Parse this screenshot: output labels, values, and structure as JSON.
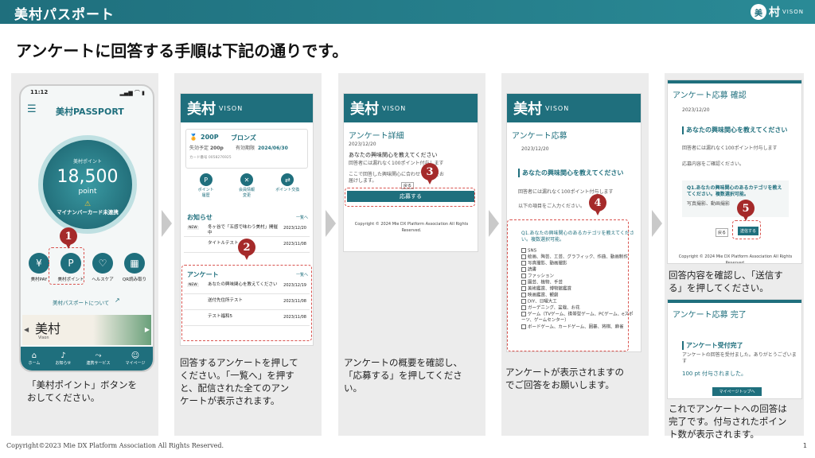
{
  "header": {
    "brand": "美村パスポート",
    "logo_mark": "美",
    "logo_text": "村",
    "logo_sub": "VISON"
  },
  "title": "アンケートに回答する手順は下記の通りです。",
  "phone": {
    "time": "11:12",
    "app_title": "美村PASSPORT",
    "points_label": "美村ポイント",
    "points_value": "18,500",
    "points_unit": "point",
    "warning": "マイナンバーカード未連携",
    "actions": [
      {
        "label": "美村PAY",
        "glyph": "¥"
      },
      {
        "label": "美村ポイント",
        "glyph": "P"
      },
      {
        "label": "ヘルスケア",
        "glyph": "♡"
      },
      {
        "label": "QR読み取り",
        "glyph": "▦"
      }
    ],
    "about_link": "美村パスポートについて",
    "banner_text": "美村",
    "banner_sub": "Vison",
    "nav": [
      {
        "label": "ホーム"
      },
      {
        "label": "お知らせ"
      },
      {
        "label": "連携サービス"
      },
      {
        "label": "マイページ"
      }
    ]
  },
  "step1": {
    "caption": "「美村ポイント」ボタンを\nおしてください。"
  },
  "step2": {
    "brand": "美村",
    "brand_sub": "VISON",
    "points": "200P",
    "rank": "ブロンズ",
    "expiry_label": "失効予定",
    "expiry_value": "200p",
    "deadline_label": "有効期限",
    "deadline_value": "2024/06/30",
    "card_label": "カード番号 0058276925",
    "icons": [
      {
        "label": "ポイント\n履歴",
        "glyph": "P"
      },
      {
        "label": "会員情報\n変更",
        "glyph": "✕"
      },
      {
        "label": "ポイント交換",
        "glyph": "⇄"
      }
    ],
    "news_title": "お知らせ",
    "more": "一覧へ",
    "news": [
      {
        "badge": "NEW",
        "text": "冬ヶ谷で「五感で味わう美村」開催中",
        "date": "2023/12/20"
      },
      {
        "badge": "",
        "text": "タイトルテスト",
        "date": "2023/11/08"
      }
    ],
    "survey_title": "アンケート",
    "survey_more": "一覧へ",
    "surveys": [
      {
        "badge": "NEW",
        "text": "あなたの興味関心を教えてください",
        "date": "2023/12/19"
      },
      {
        "badge": "",
        "text": "送付先住所テスト",
        "date": "2023/11/08"
      },
      {
        "badge": "",
        "text": "テスト福和5",
        "date": "2023/11/08"
      }
    ],
    "caption": "回答するアンケートを押して\nください。「一覧へ」を押す\nと、配信された全てのアン\nケートが表示されます。"
  },
  "step3": {
    "brand": "美村",
    "brand_sub": "VISON",
    "heading": "アンケート詳細",
    "date": "2023/12/20",
    "q_title": "あなたの興味関心を教えてください",
    "note": "回答者には漏れなく100ポイント付与します",
    "desc": "ここで回答した興味関心に合わせて情報をお届けします。",
    "back": "戻る",
    "apply": "応募する",
    "copyright": "Copyright © 2024 Mie DX Platform Association All Rights Reserved.",
    "caption": "アンケートの概要を確認し、\n「応募する」を押してくださ\nい。"
  },
  "step4": {
    "brand": "美村",
    "brand_sub": "VISON",
    "heading": "アンケート応募",
    "date": "2023/12/20",
    "q_title": "あなたの興味関心を教えてください",
    "note": "回答者には漏れなく100ポイント付与します",
    "instruction": "以下の項目をご入力ください。",
    "q1": "Q1.あなたの興味関心のあるカテゴリを教えてください。複数選択可能。",
    "options": [
      "SNS",
      "絵画、陶芸、工芸、グラフィック、作曲、動画制作",
      "写真撮影、動画撮影",
      "読書",
      "ファッション",
      "園芸、植物、手芸",
      "美術鑑賞、博物館鑑賞",
      "映画鑑賞、観劇",
      "DIY、日曜大工",
      "ガーデニング、盆栽、お花",
      "ゲーム（TVゲーム、携帯型ゲーム、PCゲーム、eスポーツ、ゲームセンター）",
      "ボードゲーム、カードゲーム、囲碁、将棋、麻雀"
    ],
    "caption": "アンケートが表示されますの\nでご回答をお願いします。"
  },
  "step5": {
    "confirm_title": "アンケート応募 確認",
    "date": "2023/12/20",
    "q_title": "あなたの興味関心を教えてください",
    "note": "回答者には漏れなく100ポイント付与します",
    "confirm_msg": "応募内容をご確認ください。",
    "q1": "Q1.あなたの興味関心のあるカテゴリを教えてください。複数選択可能。",
    "answer": "写真撮影、動画撮影",
    "back": "戻る",
    "send": "送信する",
    "copyright": "Copyright © 2024 Mie DX Platform Association All Rights Reserved.",
    "caption": "回答内容を確認し、「送信す\nる」を押してください。",
    "done_title": "アンケート応募 完了",
    "done_heading": "アンケート受付完了",
    "done_msg": "アンケートの回答を受付ました。ありがとうございます",
    "done_points": "100 pt 付与されました。",
    "mypage": "マイページトップへ",
    "done_caption": "これでアンケートへの回答は\n完了です。付与されたポイン\nト数が表示されます。"
  },
  "markers": [
    "1",
    "2",
    "3",
    "4",
    "5"
  ],
  "footer": "Copyright©2023 Mie DX Platform Association All Rights Reserved.",
  "page_number": "1"
}
